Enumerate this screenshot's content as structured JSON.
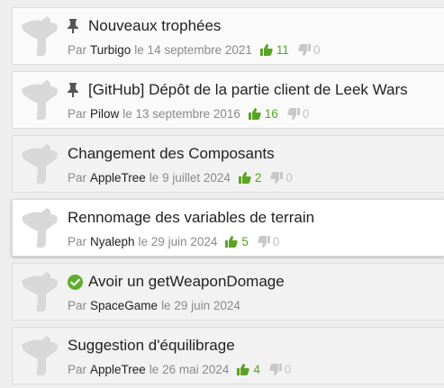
{
  "colors": {
    "upvote": "#5ba323",
    "downvote": "#c8c8c8",
    "resolved": "#5fad2f",
    "avatar_placeholder": "#d8d8d8"
  },
  "labels": {
    "by": "Par"
  },
  "topics": [
    {
      "icon": "pin-icon",
      "title": "Nouveaux trophées",
      "author": "Turbigo",
      "date": "le 14 septembre 2021",
      "up": "11",
      "down": "0"
    },
    {
      "icon": "pin-icon",
      "title": "[GitHub] Dépôt de la partie client de Leek Wars",
      "author": "Pilow",
      "date": "le 13 septembre 2016",
      "up": "16",
      "down": "0"
    },
    {
      "title": "Changement des Composants",
      "author": "AppleTree",
      "date": "le 9 juillet 2024",
      "up": "2",
      "down": "0"
    },
    {
      "title": "Rennomage des variables de terrain",
      "author": "Nyaleph",
      "date": "le 29 juin 2024",
      "up": "5",
      "down": "0"
    },
    {
      "icon": "check-icon",
      "title": "Avoir un getWeaponDomage",
      "author": "SpaceGame",
      "date": "le 29 juin 2024"
    },
    {
      "title": "Suggestion d'équilibrage",
      "author": "AppleTree",
      "date": "le 26 mai 2024",
      "up": "4",
      "down": "0"
    }
  ]
}
